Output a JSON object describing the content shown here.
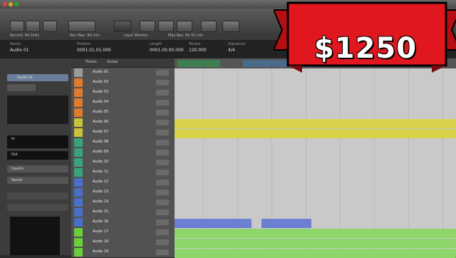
{
  "banner": {
    "price": "$1250",
    "bg_color": "#e0171e"
  },
  "app": {
    "accent": "#3a7bd5"
  },
  "toolbar": {
    "buttons": [
      "rewind",
      "play",
      "stop",
      "record",
      "cycle",
      "metronome",
      "mixer",
      "editor"
    ]
  },
  "infobar": {
    "items": [
      "Record: 44.1kHz",
      "Rec Max: 94 min",
      "Input Monitor",
      "Max Rec: 6h 52 min"
    ]
  },
  "fields": [
    {
      "label": "Name",
      "value": "Audio 01"
    },
    {
      "label": "Position",
      "value": "0001.01.01.000"
    },
    {
      "label": "Length",
      "value": "0001.00.00.000"
    },
    {
      "label": "Tempo",
      "value": "120.000"
    },
    {
      "label": "Signature",
      "value": "4/4"
    }
  ],
  "inspector": {
    "title": "Audio 01",
    "labels": [
      "In",
      "Out",
      "Inserts",
      "Sends"
    ]
  },
  "tracklist": {
    "tabs": [
      "Tracks",
      "Zones"
    ]
  },
  "tracks": [
    {
      "name": "Audio 01",
      "color": "#9a9a9a"
    },
    {
      "name": "Audio 02",
      "color": "#e07b2e"
    },
    {
      "name": "Audio 03",
      "color": "#e07b2e"
    },
    {
      "name": "Audio 04",
      "color": "#e07b2e"
    },
    {
      "name": "Audio 05",
      "color": "#e07b2e"
    },
    {
      "name": "Audio 06",
      "color": "#c9c23a"
    },
    {
      "name": "Audio 07",
      "color": "#c9c23a"
    },
    {
      "name": "Audio 08",
      "color": "#3aa37a"
    },
    {
      "name": "Audio 09",
      "color": "#3aa37a"
    },
    {
      "name": "Audio 10",
      "color": "#3aa37a"
    },
    {
      "name": "Audio 11",
      "color": "#3aa37a"
    },
    {
      "name": "Audio 12",
      "color": "#4a6fc9"
    },
    {
      "name": "Audio 13",
      "color": "#4a6fc9"
    },
    {
      "name": "Audio 14",
      "color": "#4a6fc9"
    },
    {
      "name": "Audio 15",
      "color": "#4a6fc9"
    },
    {
      "name": "Audio 16",
      "color": "#4a6fc9"
    },
    {
      "name": "Audio 17",
      "color": "#6ccf3a"
    },
    {
      "name": "Audio 18",
      "color": "#6ccf3a"
    },
    {
      "name": "Audio 19",
      "color": "#6ccf3a"
    }
  ]
}
